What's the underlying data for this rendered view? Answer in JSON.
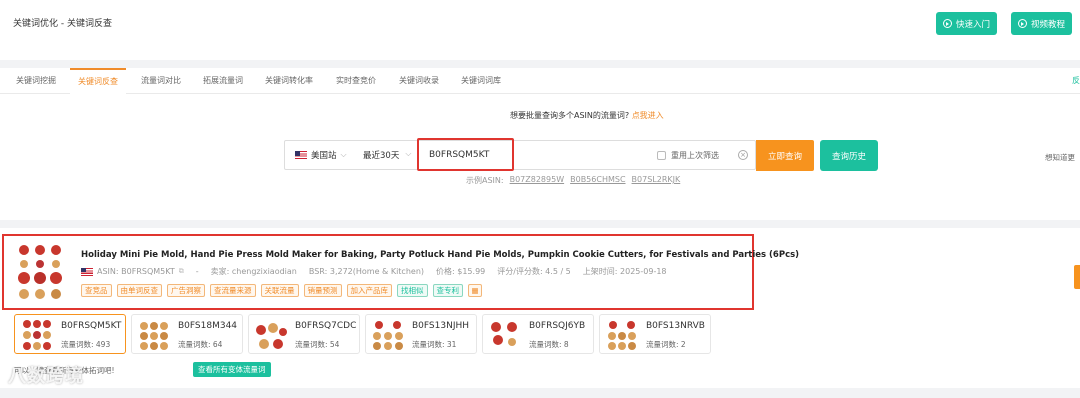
{
  "header": {
    "breadcrumb": "关键词优化 - 关键词反查",
    "quick_start": "快速入门",
    "video_tutorial": "视频教程"
  },
  "tabs": [
    {
      "label": "关键词挖掘",
      "active": false
    },
    {
      "label": "关键词反查",
      "active": true
    },
    {
      "label": "流量词对比",
      "active": false
    },
    {
      "label": "拓展流量词",
      "active": false
    },
    {
      "label": "关键词转化率",
      "active": false
    },
    {
      "label": "实时查竞价",
      "active": false
    },
    {
      "label": "关键词收录",
      "active": false
    },
    {
      "label": "关键词词库",
      "active": false
    }
  ],
  "tab_right": "反",
  "search": {
    "batch_tip": "想要批量查询多个ASIN的流量词?",
    "batch_link": "点我进入",
    "site": "美国站",
    "period": "最近30天",
    "asin_value": "B0FRSQM5KT",
    "reuse_filter": "重用上次筛选",
    "query_button": "立即查询",
    "history_button": "查询历史",
    "example_label": "示例ASIN:",
    "examples": [
      "B07Z82895W",
      "B0B56CHMSC",
      "B07SL2RKJK"
    ],
    "side_tip": "想知道更"
  },
  "product": {
    "title": "Holiday Mini Pie Mold, Hand Pie Press Mold Maker for Baking, Party Potluck Hand Pie Molds, Pumpkin Cookie Cutters, for Festivals and Parties (6Pcs)",
    "asin": "ASIN: B0FRSQM5KT",
    "dash": "-",
    "seller": "卖家: chengzixiaodian",
    "bsr": "BSR: 3,272(Home & Kitchen)",
    "price": "价格: $15.99",
    "rating": "评分/评分数: 4.5 / 5",
    "listed": "上架时间: 2025-09-18",
    "tags": [
      {
        "label": "查竞品",
        "style": "orange"
      },
      {
        "label": "由单词反查",
        "style": "orange"
      },
      {
        "label": "广告洞察",
        "style": "orange"
      },
      {
        "label": "查流量来源",
        "style": "orange"
      },
      {
        "label": "关联流量",
        "style": "orange"
      },
      {
        "label": "销量预测",
        "style": "orange"
      },
      {
        "label": "加入产品库",
        "style": "orange"
      },
      {
        "label": "找相似",
        "style": "green"
      },
      {
        "label": "查专利",
        "style": "green"
      }
    ]
  },
  "variants": [
    {
      "asin": "B0FRSQM5KT",
      "count": "流量词数: 493",
      "selected": true
    },
    {
      "asin": "B0FS18M344",
      "count": "流量词数: 64",
      "selected": false
    },
    {
      "asin": "B0FRSQ7CDC",
      "count": "流量词数: 54",
      "selected": false
    },
    {
      "asin": "B0FS13NJHH",
      "count": "流量词数: 31",
      "selected": false
    },
    {
      "asin": "B0FRSQJ6YB",
      "count": "流量词数: 8",
      "selected": false
    },
    {
      "asin": "B0FS13NRVB",
      "count": "流量词数: 2",
      "selected": false
    }
  ],
  "variants_tip": "可以一键查看所有变体拓词吧!",
  "all_variants_button": "查看所有变体流量词",
  "watermark": "八数跨境",
  "colors": {
    "accent_orange": "#f7931e",
    "accent_green": "#1cc09e",
    "highlight_red": "#e0352f"
  }
}
